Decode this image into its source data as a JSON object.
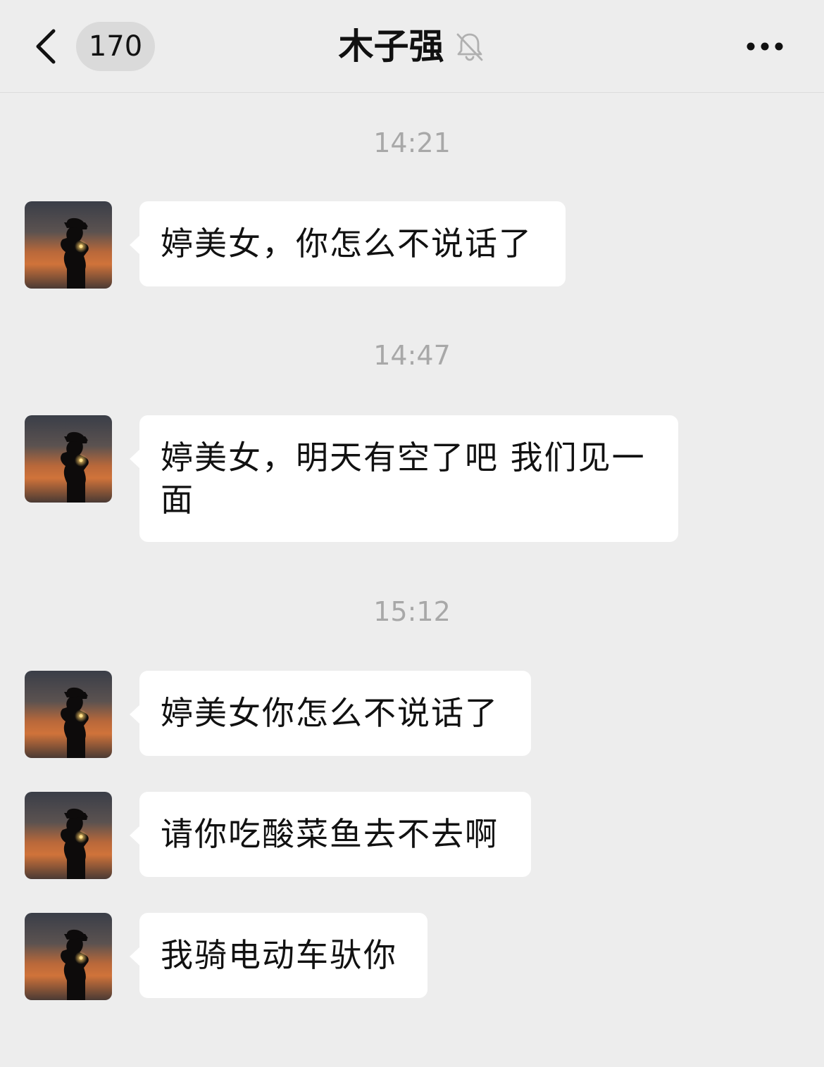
{
  "header": {
    "back_icon": "chevron-left-icon",
    "unread_count": "170",
    "title": "木子强",
    "mute_icon": "bell-muted-icon",
    "more_icon": "more-dots-icon"
  },
  "chat": {
    "timestamps": [
      "14:21",
      "14:47",
      "15:12"
    ],
    "messages": [
      {
        "text": "婷美女，你怎么不说话了"
      },
      {
        "text": "婷美女，明天有空了吧 我们见一面"
      },
      {
        "text": "婷美女你怎么不说话了"
      },
      {
        "text": "请你吃酸菜鱼去不去啊"
      },
      {
        "text": "我骑电动车驮你"
      }
    ]
  },
  "colors": {
    "background": "#ededed",
    "bubble": "#ffffff",
    "badge": "#dadada",
    "timestamp": "#a8a8a8"
  }
}
